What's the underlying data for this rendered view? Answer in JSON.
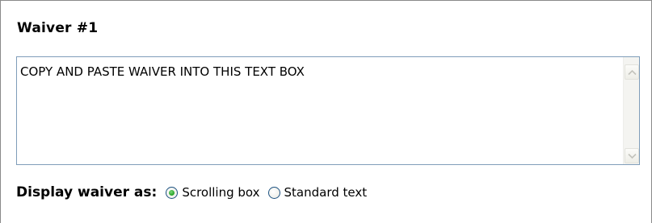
{
  "waiver": {
    "title": "Waiver #1",
    "textbox_value": "COPY AND PASTE WAIVER INTO THIS TEXT BOX"
  },
  "display": {
    "label": "Display waiver as:",
    "options": [
      {
        "label": "Scrolling box",
        "selected": true
      },
      {
        "label": "Standard text",
        "selected": false
      }
    ]
  },
  "colors": {
    "textbox_border": "#7f9db9",
    "radio_border": "#1c5180",
    "radio_selected_dot": "#21a121"
  }
}
